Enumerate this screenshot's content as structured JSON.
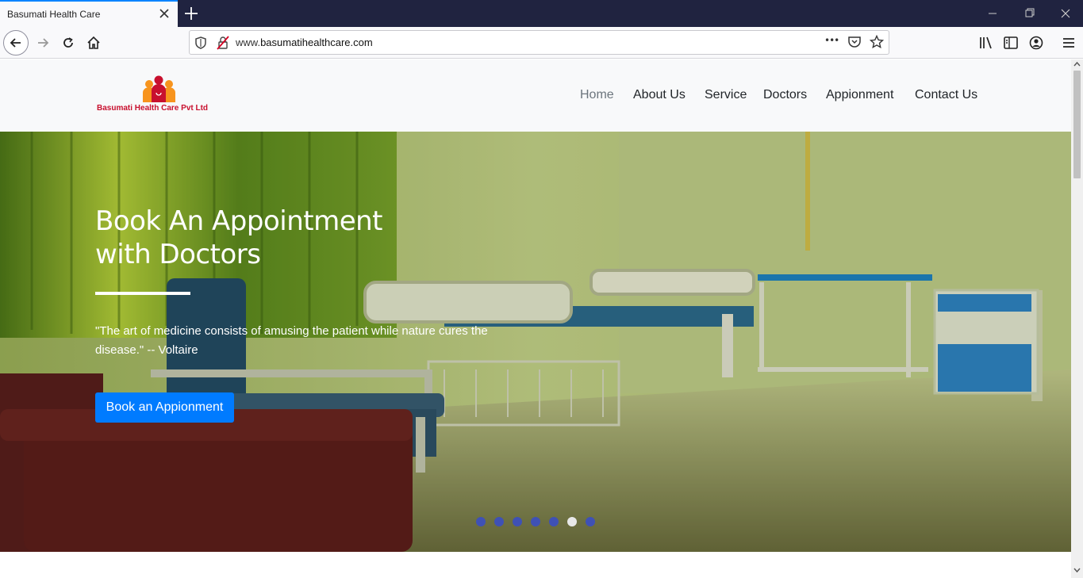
{
  "browser": {
    "tab_title": "Basumati Health Care",
    "url_prefix": "www.",
    "url_domain": "basumatihealthcare.com",
    "url_dots": "•••"
  },
  "site": {
    "logo_text": "Basumati Health Care Pvt Ltd",
    "menu": [
      {
        "label": "Home",
        "active": true
      },
      {
        "label": "About Us"
      },
      {
        "label": "Service"
      },
      {
        "label": "Doctors"
      },
      {
        "label": "Appionment"
      },
      {
        "label": "Contact Us"
      }
    ]
  },
  "hero": {
    "title_line1": "Book An Appointment",
    "title_line2": "with Doctors",
    "quote": "\"The art of medicine consists of amusing the patient while nature cures the disease.\" -- Voltaire",
    "button_label": "Book an Appionment",
    "slide_count": 7,
    "active_slide": 6
  },
  "colors": {
    "accent": "#007bff",
    "logo_red": "#c8102e",
    "dot": "#3f51b5",
    "tab_border": "#0a84ff"
  }
}
